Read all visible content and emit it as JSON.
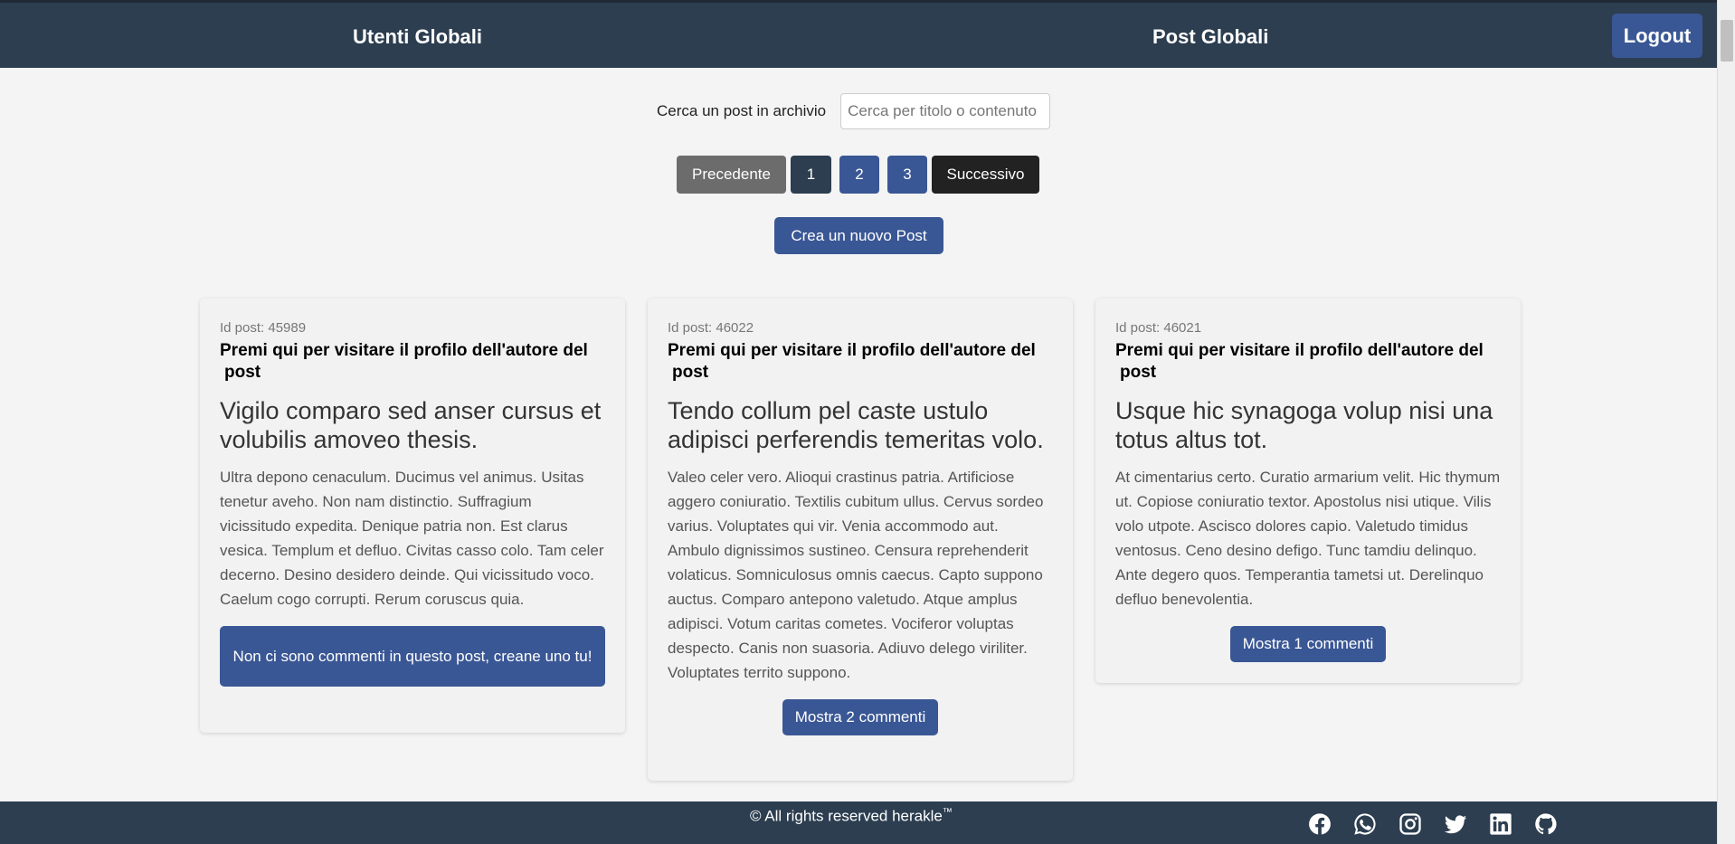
{
  "nav": {
    "users_label": "Utenti Globali",
    "posts_label": "Post Globali",
    "logout_label": "Logout"
  },
  "search": {
    "label": "Cerca un post in archivio",
    "placeholder": "Cerca per titolo o contenuto",
    "value": ""
  },
  "pagination": {
    "prev_label": "Precedente",
    "pages": [
      "1",
      "2",
      "3"
    ],
    "current_page": "1",
    "next_label": "Successivo"
  },
  "create_post_label": "Crea un nuovo Post",
  "posts": [
    {
      "id_text": "Id post: 45989",
      "author_link": "Premi qui per visitare il profilo dell'autore del post",
      "title": "Vigilo comparo sed anser cursus et volubilis amoveo thesis.",
      "body": "Ultra depono cenaculum. Ducimus vel animus. Usitas tenetur aveho. Non nam distinctio. Suffragium vicissitudo expedita. Denique patria non. Est clarus vesica. Templum et defluo. Civitas casso colo. Tam celer decerno. Desino desidero deinde. Qui vicissitudo voco. Caelum cogo corrupti. Rerum coruscus quia.",
      "comment_button": "Non ci sono commenti in questo post, creane uno tu!"
    },
    {
      "id_text": "Id post: 46022",
      "author_link": "Premi qui per visitare il profilo dell'autore del post",
      "title": "Tendo collum pel caste ustulo adipisci perferendis temeritas volo.",
      "body": "Valeo celer vero. Alioqui crastinus patria. Artificiose aggero coniuratio. Textilis cubitum ullus. Cervus sordeo varius. Voluptates qui vir. Venia accommodo aut. Ambulo dignissimos sustineo. Censura reprehenderit volaticus. Somniculosus omnis caecus. Capto suppono auctus. Comparo antepono valetudo. Atque amplus adipisci. Votum caritas cometes. Vociferor voluptas despecto. Canis non suasoria. Adiuvo delego viriliter. Voluptates territo suppono.",
      "comment_button": "Mostra 2 commenti"
    },
    {
      "id_text": "Id post: 46021",
      "author_link": "Premi qui per visitare il profilo dell'autore del post",
      "title": "Usque hic synagoga volup nisi una totus altus tot.",
      "body": "At cimentarius certo. Curatio armarium velit. Hic thymum ut. Copiose coniuratio textor. Apostolus nisi utique. Vilis volo utpote. Ascisco dolores capio. Valetudo timidus ventosus. Ceno desino defigo. Tunc tamdiu delinquo. Ante degero quos. Temperantia tametsi ut. Derelinquo defluo benevolentia.",
      "comment_button": "Mostra 1 commenti"
    }
  ],
  "footer": {
    "copyright": "© All rights reserved herakle",
    "trademark": "™",
    "social_icons": [
      "facebook-icon",
      "whatsapp-icon",
      "instagram-icon",
      "twitter-icon",
      "linkedin-icon",
      "github-icon"
    ]
  },
  "colors": {
    "navbar": "#2c3e50",
    "primary_button": "#3a5795",
    "page_background": "#f4f4f4",
    "card_background": "#f2f2f2"
  }
}
